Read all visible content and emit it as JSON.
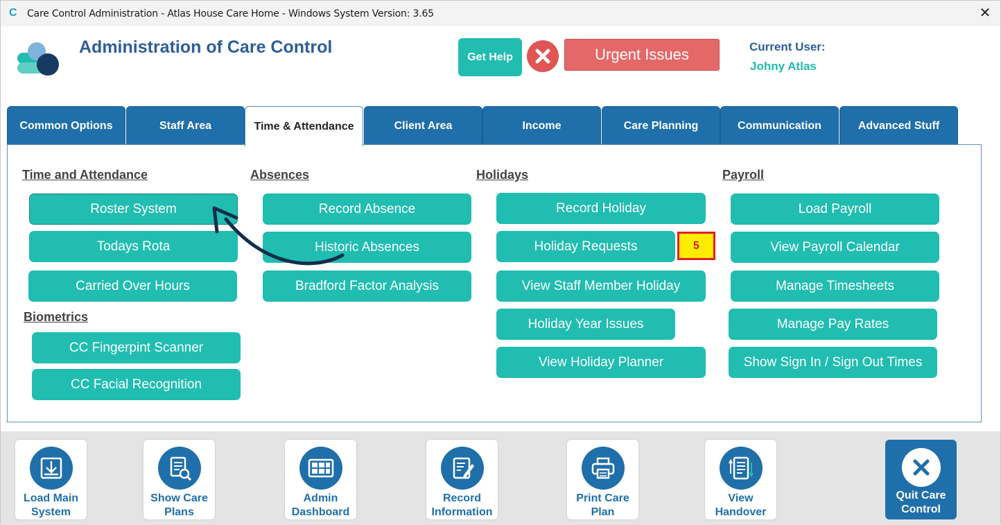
{
  "window": {
    "title": "Care Control Administration - Atlas House Care Home - Windows System Version: 3.65",
    "close_glyph": "✕"
  },
  "header": {
    "heading": "Administration of Care Control",
    "get_help": "Get Help",
    "urgent": "Urgent Issues",
    "current_user_label": "Current User:",
    "current_user_name": "Johny Atlas"
  },
  "tabs": [
    {
      "label": "Common Options"
    },
    {
      "label": "Staff Area"
    },
    {
      "label": "Time & Attendance",
      "active": true
    },
    {
      "label": "Client Area"
    },
    {
      "label": "Income"
    },
    {
      "label": "Care Planning"
    },
    {
      "label": "Communication"
    },
    {
      "label": "Advanced Stuff"
    }
  ],
  "sections": {
    "time_attendance": {
      "title": "Time and Attendance",
      "buttons": [
        "Roster System",
        "Todays Rota",
        "Carried Over Hours"
      ]
    },
    "biometrics": {
      "title": "Biometrics",
      "buttons": [
        "CC Fingerpint Scanner",
        "CC Facial Recognition"
      ]
    },
    "absences": {
      "title": "Absences",
      "buttons": [
        "Record Absence",
        "Historic Absences",
        "Bradford Factor Analysis"
      ]
    },
    "holidays": {
      "title": "Holidays",
      "buttons": [
        "Record Holiday",
        "Holiday Requests",
        "View Staff Member Holiday",
        "Holiday Year Issues",
        "View Holiday Planner"
      ],
      "requests_badge": "5"
    },
    "payroll": {
      "title": "Payroll",
      "buttons": [
        "Load Payroll",
        "View Payroll Calendar",
        "Manage Timesheets",
        "Manage Pay Rates",
        "Show Sign In / Sign Out Times"
      ]
    }
  },
  "footer": [
    {
      "line1": "Load Main",
      "line2": "System",
      "icon": "download-icon"
    },
    {
      "line1": "Show Care",
      "line2": "Plans",
      "icon": "document-search-icon"
    },
    {
      "line1": "Admin",
      "line2": "Dashboard",
      "icon": "dashboard-icon"
    },
    {
      "line1": "Record",
      "line2": "Information",
      "icon": "edit-document-icon"
    },
    {
      "line1": "Print Care",
      "line2": "Plan",
      "icon": "printer-icon"
    },
    {
      "line1": "View",
      "line2": "Handover",
      "icon": "handover-list-icon"
    }
  ],
  "quit": {
    "line1": "Quit Care",
    "line2": "Control",
    "icon": "close-circle-icon"
  },
  "colors": {
    "teal": "#20bdb0",
    "blue": "#1f6faa",
    "heading": "#2e5d9a",
    "urgent": "#e46868",
    "badge_bg": "#ffec00",
    "badge_border": "#e0202a"
  }
}
